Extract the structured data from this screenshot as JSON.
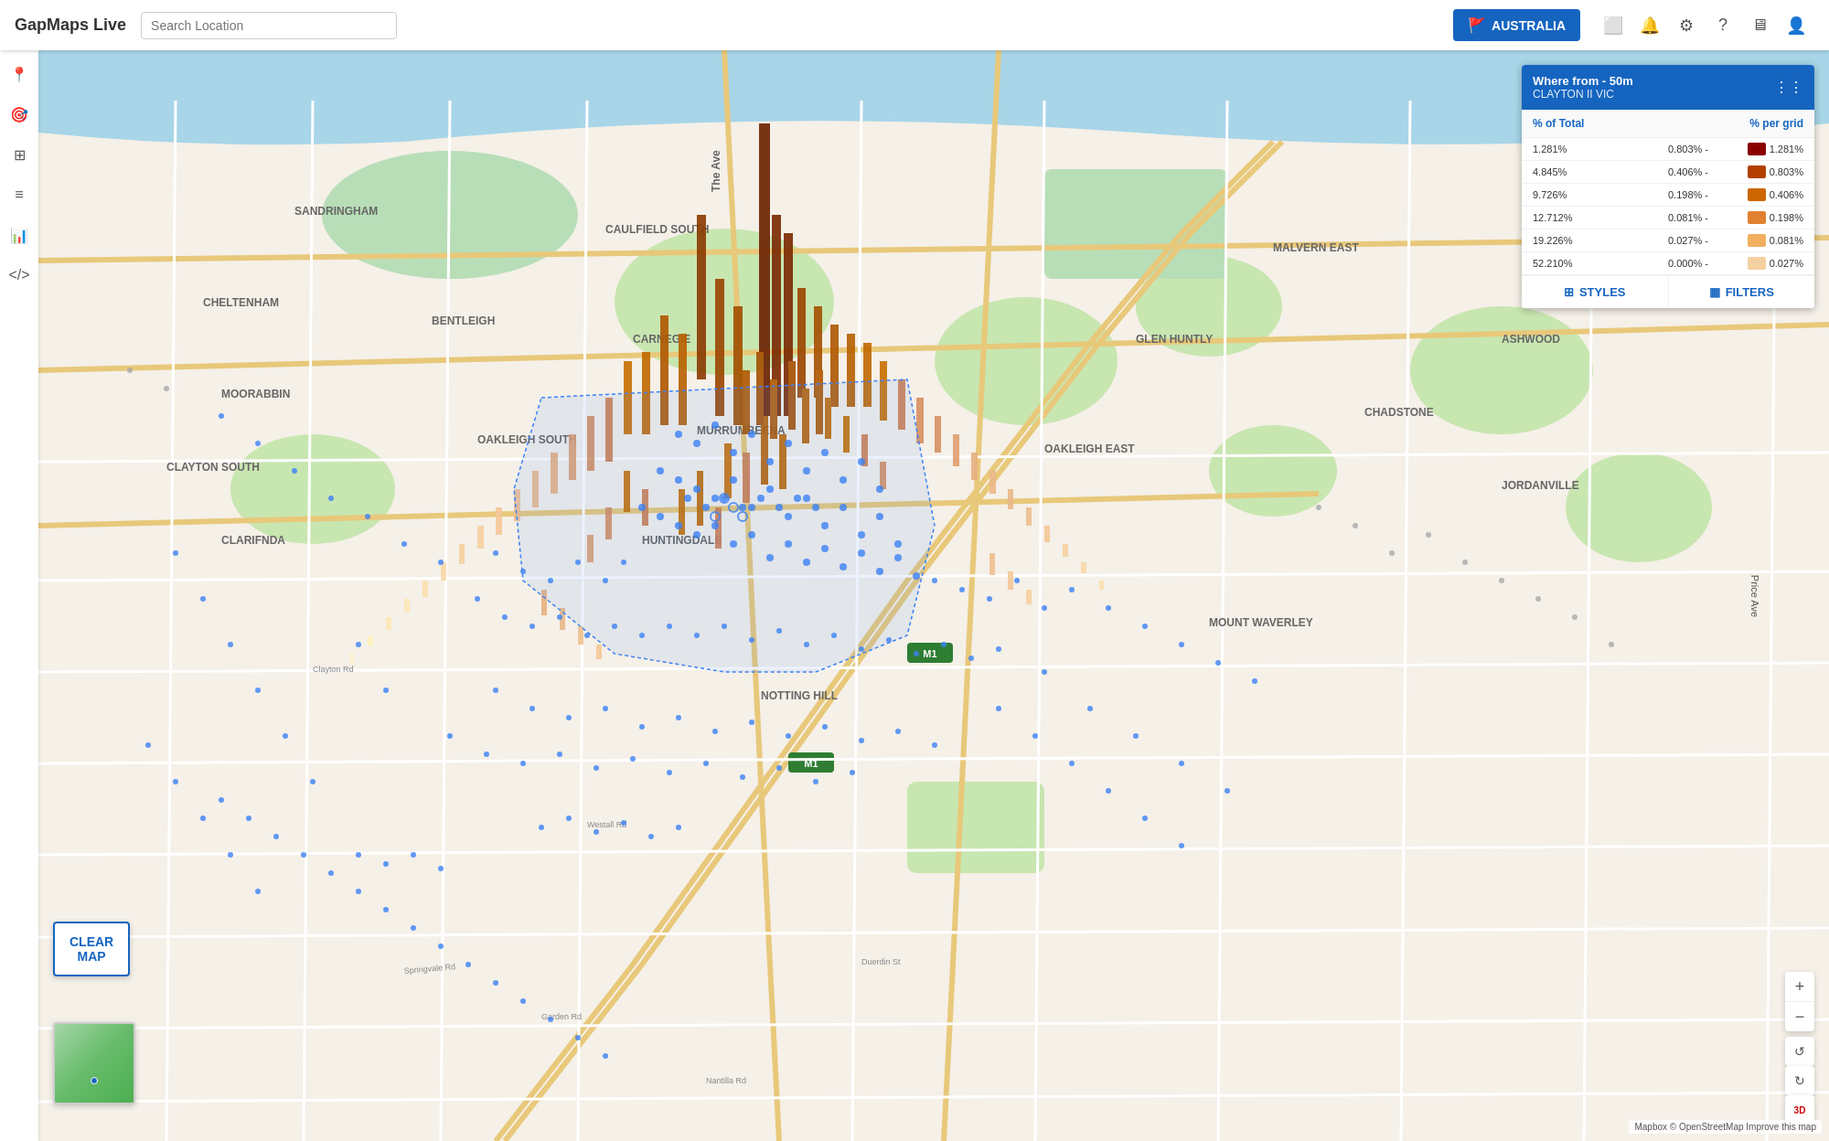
{
  "app": {
    "title": "GapMaps Live"
  },
  "header": {
    "search_placeholder": "Search Location",
    "country_button": "AUSTRALIA",
    "icons": [
      "ruler-icon",
      "notification-icon",
      "settings-icon",
      "help-icon",
      "display-icon",
      "user-icon"
    ]
  },
  "sidebar": {
    "icons": [
      "location-pin-icon",
      "location-circle-icon",
      "grid-icon",
      "layers-icon",
      "analytics-icon",
      "code-icon"
    ]
  },
  "info_panel": {
    "title": "Where from - 50m",
    "subtitle": "CLAYTON II VIC",
    "col1_header": "% of Total",
    "col2_header": "% per grid",
    "rows": [
      {
        "val1": "1.281%",
        "range": "0.803% -",
        "val2": "1.281%",
        "color": "#8B0000"
      },
      {
        "val1": "4.845%",
        "range": "0.406% -",
        "val2": "0.803%",
        "color": "#b34000"
      },
      {
        "val1": "9.726%",
        "range": "0.198% -",
        "val2": "0.406%",
        "color": "#cc6600"
      },
      {
        "val1": "12.712%",
        "range": "0.081% -",
        "val2": "0.198%",
        "color": "#e08030"
      },
      {
        "val1": "19.226%",
        "range": "0.027% -",
        "val2": "0.081%",
        "color": "#f0b060"
      },
      {
        "val1": "52.210%",
        "range": "0.000% -",
        "val2": "0.027%",
        "color": "#f5d0a0"
      }
    ],
    "styles_label": "STYLES",
    "filters_label": "FILTERS"
  },
  "map_controls": {
    "zoom_in": "+",
    "zoom_out": "−"
  },
  "clear_map": {
    "line1": "CLEAR",
    "line2": "MAP"
  },
  "attribution": {
    "text": "Mapbox © OpenStreetMap  Improve this map"
  },
  "map_labels": {
    "the_ave": "The Ave",
    "suburbs": [
      "SANDRINGHAM",
      "MOORABBIN",
      "BENTLEIGH EAST",
      "CARNEGIE",
      "MURRUMBEENA",
      "OAKLEIGH SOUTH",
      "HUNTINGDALE",
      "NOTTING HILL",
      "CLAYTON SOUTH",
      "CLARINDA",
      "CHADSTONE",
      "JORDANVILLE",
      "ASHWOOD",
      "WAVERLEY"
    ]
  },
  "price_label": "Price Ave"
}
